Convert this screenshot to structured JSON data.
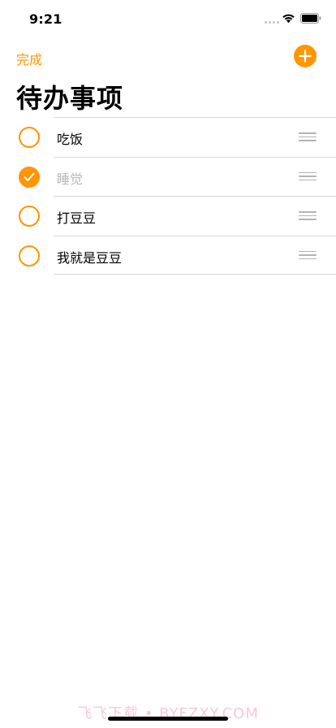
{
  "status_bar": {
    "time": "9:21",
    "icons": [
      "cellular-signal-icon",
      "wifi-icon",
      "battery-icon"
    ]
  },
  "nav": {
    "done_label": "完成",
    "add_icon": "plus-circle-icon"
  },
  "title": "待办事项",
  "accent_color": "#ff9500",
  "todos": [
    {
      "label": "吃饭",
      "checked": false
    },
    {
      "label": "睡觉",
      "checked": true
    },
    {
      "label": "打豆豆",
      "checked": false
    },
    {
      "label": "我就是豆豆",
      "checked": false
    }
  ],
  "watermark": "飞飞下载 • BYFZXY.COM"
}
